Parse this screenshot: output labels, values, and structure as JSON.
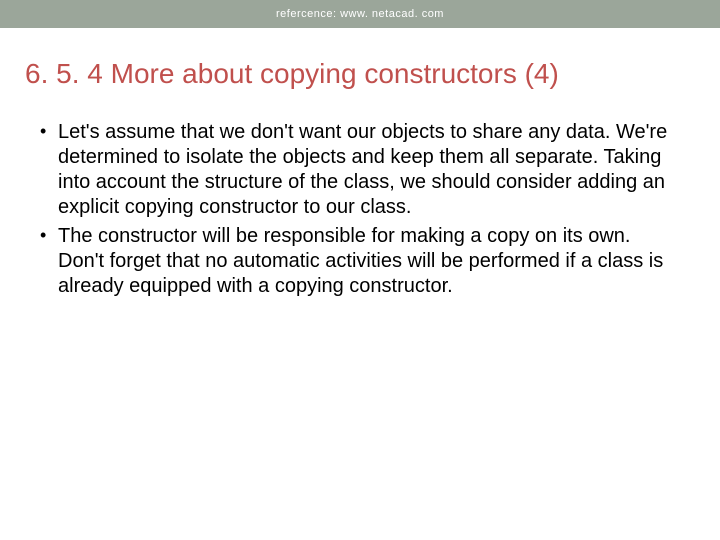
{
  "header": {
    "reference_text": "refercence: www. netacad. com"
  },
  "title": "6. 5. 4 More about copying constructors (4)",
  "bullets": [
    "Let's assume that we don't want our objects to share any data. We're determined to isolate the objects and keep them all separate. Taking into account the structure of the class, we should consider adding an explicit copying constructor to our class.",
    "The constructor will be responsible for making a copy on its own. Don't forget that no automatic activities will be performed if a class is already equipped with a copying constructor."
  ]
}
